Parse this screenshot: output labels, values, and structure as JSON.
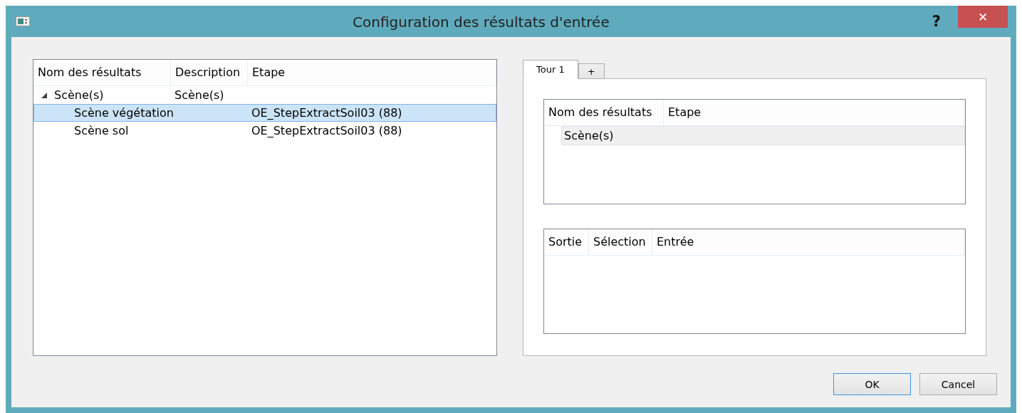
{
  "window": {
    "title": "Configuration des résultats d'entrée",
    "help": "?",
    "close": "✕"
  },
  "tree": {
    "columns": [
      "Nom des résultats",
      "Description",
      "Etape"
    ],
    "items": [
      {
        "name": "Scène(s)",
        "description": "Scène(s)",
        "expanded": true,
        "selected": false,
        "children": [
          {
            "name": "Scène végétation",
            "step": "OE_StepExtractSoil03 (88)",
            "selected": true
          },
          {
            "name": "Scène sol",
            "step": "OE_StepExtractSoil03 (88)",
            "selected": false
          }
        ]
      }
    ]
  },
  "tabs": [
    {
      "label": "Tour 1",
      "selected": true
    },
    {
      "label": "+",
      "selected": false
    }
  ],
  "results_table": {
    "columns": [
      "Nom des résultats",
      "Etape"
    ],
    "rows": [
      {
        "name": "Scène(s)",
        "selected": true
      }
    ]
  },
  "mapping_table": {
    "columns": [
      "Sortie",
      "Sélection",
      "Entrée"
    ]
  },
  "buttons": [
    {
      "label": "OK",
      "default": true
    },
    {
      "label": "Cancel",
      "default": false
    }
  ]
}
